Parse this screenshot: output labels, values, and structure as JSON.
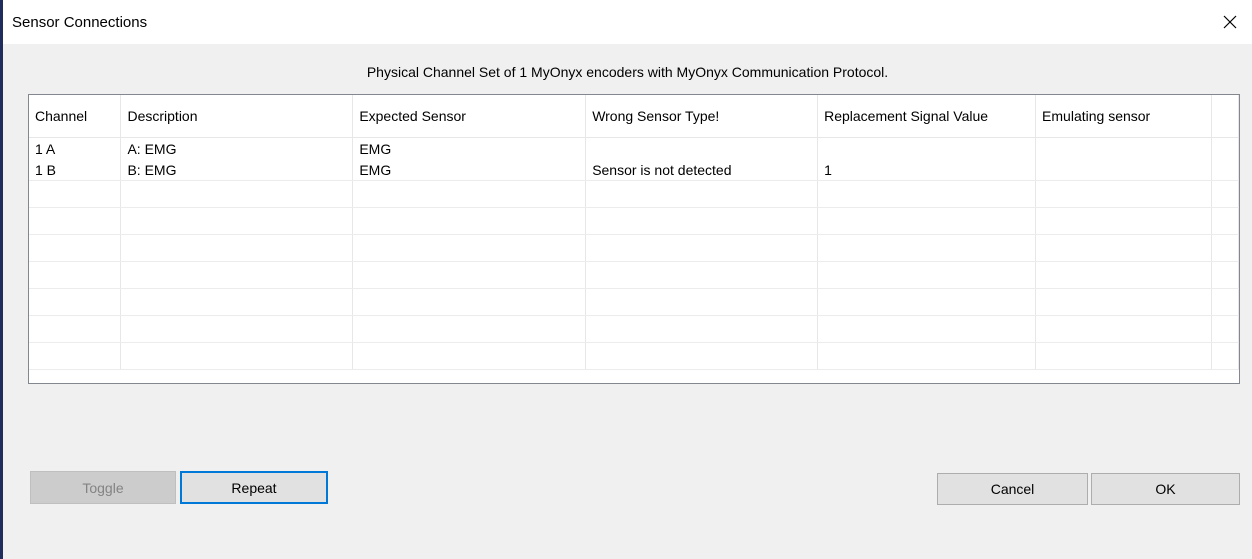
{
  "window": {
    "title": "Sensor Connections"
  },
  "dialog": {
    "subtitle": "Physical Channel Set of 1 MyOnyx encoders with MyOnyx Communication Protocol."
  },
  "table": {
    "headers": [
      "Channel",
      "Description",
      "Expected Sensor",
      "Wrong Sensor Type!",
      "Replacement Signal Value",
      "Emulating sensor"
    ],
    "rows": [
      [
        "1 A",
        "A: EMG",
        "EMG",
        "",
        "",
        ""
      ],
      [
        "1 B",
        "B: EMG",
        "EMG",
        "Sensor is not detected",
        "1",
        ""
      ]
    ]
  },
  "buttons": {
    "toggle": "Toggle",
    "repeat": "Repeat",
    "cancel": "Cancel",
    "ok": "OK"
  },
  "icons": {
    "close": "close-icon"
  }
}
